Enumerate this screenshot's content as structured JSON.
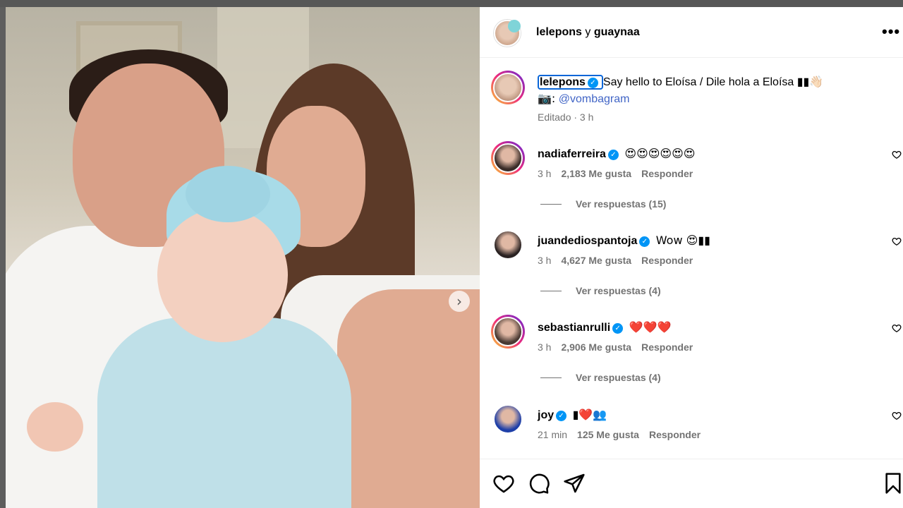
{
  "post": {
    "author_line": {
      "user1": "lelepons",
      "connector": "y",
      "user2": "guaynaa"
    },
    "caption": {
      "username": "lelepons",
      "text": "Say hello to Eloísa / Dile hola a Eloísa ▮▮👋🏻",
      "credit_prefix": "📷:",
      "credit_link": "@vombagram",
      "edited": "Editado · 3 h"
    }
  },
  "comments": [
    {
      "username": "nadiaferreira",
      "verified": true,
      "text": "😍😍😍😍😍😍",
      "time": "3 h",
      "likes": "2,183 Me gusta",
      "reply": "Responder",
      "replies": "Ver respuestas (15)",
      "ring": true,
      "avatar_color": "#3a2c28"
    },
    {
      "username": "juandediospantoja",
      "verified": true,
      "text": "Wow 😍▮▮",
      "time": "3 h",
      "likes": "4,627 Me gusta",
      "reply": "Responder",
      "replies": "Ver respuestas (4)",
      "ring": false,
      "avatar_color": "#2a2222"
    },
    {
      "username": "sebastianrulli",
      "verified": true,
      "text": "❤️❤️❤️",
      "time": "3 h",
      "likes": "2,906 Me gusta",
      "reply": "Responder",
      "replies": "Ver respuestas (4)",
      "ring": true,
      "avatar_color": "#4a3a33"
    },
    {
      "username": "joy",
      "verified": true,
      "text": "▮❤️👥",
      "time": "21 min",
      "likes": "125 Me gusta",
      "reply": "Responder",
      "replies": "",
      "ring": false,
      "avatar_color": "#1e3fa8"
    }
  ],
  "icons": {
    "more": "more-options-icon",
    "next": "chevron-right-icon",
    "like": "heart-icon",
    "comment": "comment-icon",
    "share": "send-icon",
    "save": "bookmark-icon"
  },
  "colors": {
    "verified": "#0095f6",
    "link": "#4165c6",
    "muted": "#737373"
  }
}
